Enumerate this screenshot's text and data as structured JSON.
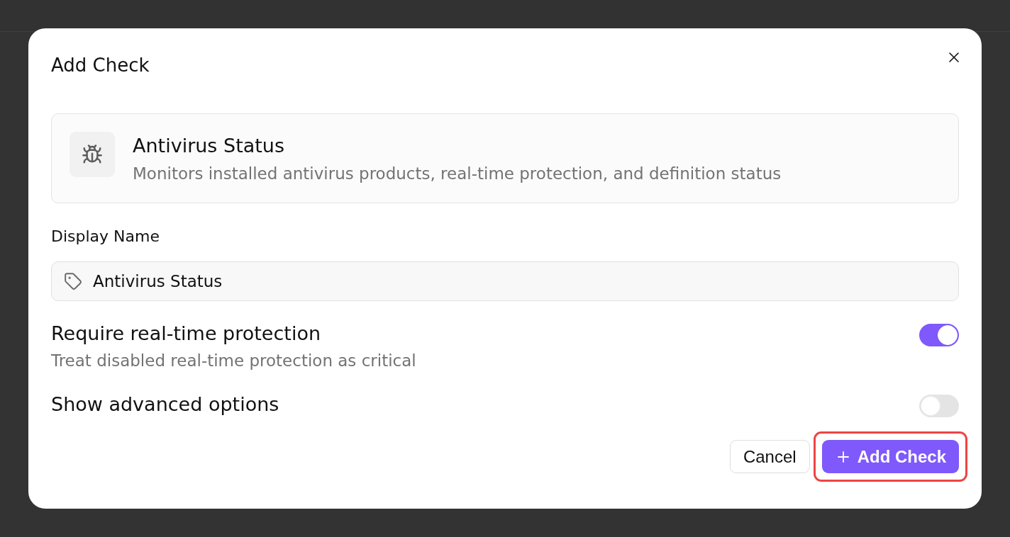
{
  "dialog": {
    "title": "Add Check"
  },
  "check": {
    "name": "Antivirus Status",
    "description": "Monitors installed antivirus products, real-time protection, and definition status"
  },
  "display_name": {
    "label": "Display Name",
    "value": "Antivirus Status"
  },
  "options": [
    {
      "label": "Require real-time protection",
      "description": "Treat disabled real-time protection as critical",
      "on": true
    },
    {
      "label": "Show advanced options",
      "on": false
    }
  ],
  "buttons": [
    {
      "label": "Cancel",
      "kind": "secondary",
      "highlighted": false
    },
    {
      "label": "Add Check",
      "kind": "primary",
      "highlighted": true
    }
  ]
}
